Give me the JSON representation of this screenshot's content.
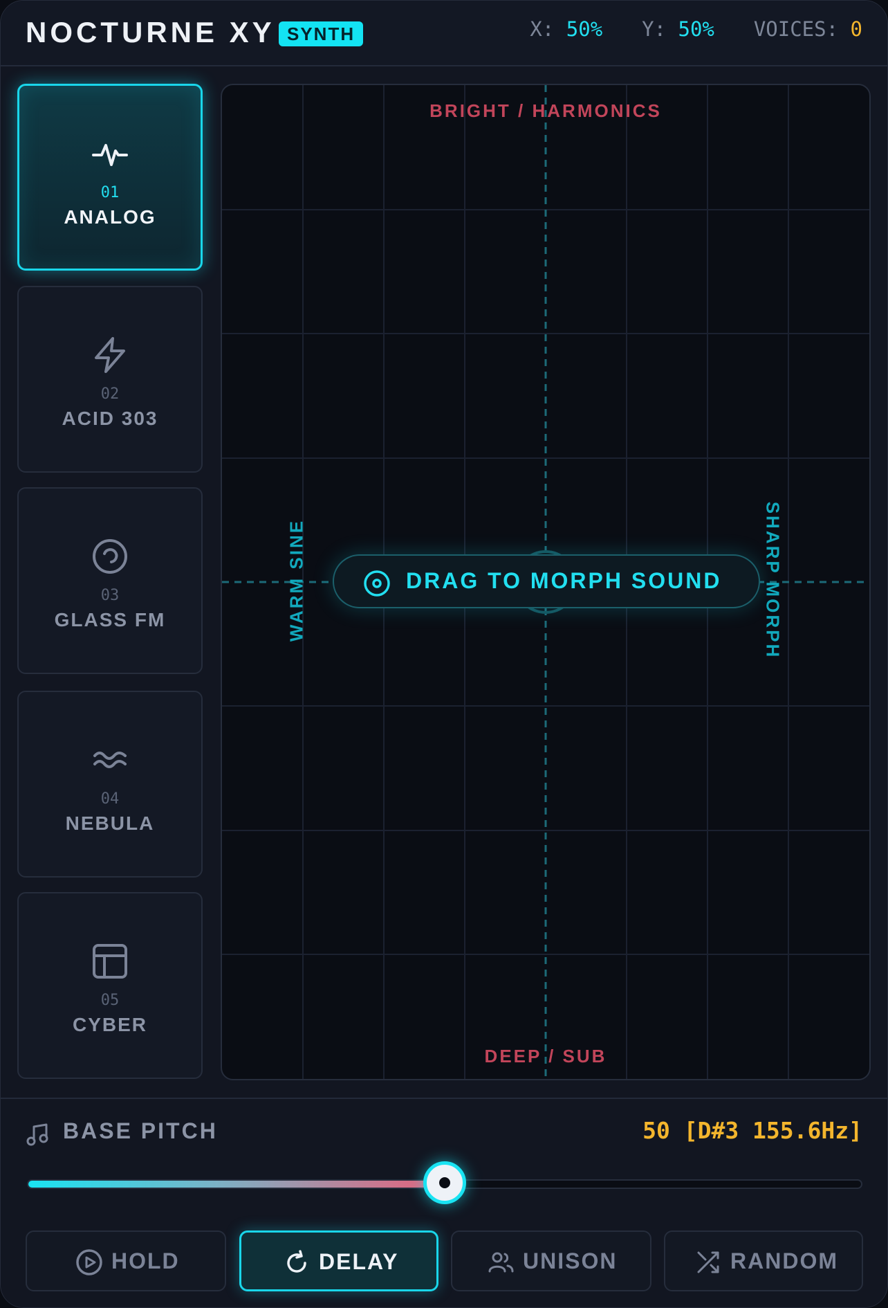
{
  "header": {
    "title": "NOCTURNE XY",
    "badge": "SYNTH",
    "stats": {
      "x_label": "X:",
      "x_value": "50%",
      "y_label": "Y:",
      "y_value": "50%",
      "voices_label": "VOICES:",
      "voices_value": "0"
    }
  },
  "presets": [
    {
      "num": "01",
      "name": "ANALOG",
      "icon": "pulse-wave-icon",
      "active": true
    },
    {
      "num": "02",
      "name": "ACID 303",
      "icon": "lightning-bolt-icon",
      "active": false
    },
    {
      "num": "03",
      "name": "GLASS FM",
      "icon": "spiral-icon",
      "active": false
    },
    {
      "num": "04",
      "name": "NEBULA",
      "icon": "waves-icon",
      "active": false
    },
    {
      "num": "05",
      "name": "CYBER",
      "icon": "layout-panel-icon",
      "active": false
    }
  ],
  "pad": {
    "top_label": "BRIGHT / HARMONICS",
    "bottom_label": "DEEP / SUB",
    "left_label": "WARM SINE",
    "right_label": "SHARP MORPH",
    "hint": "DRAG TO MORPH SOUND",
    "x_percent": 50,
    "y_percent": 50
  },
  "pitch": {
    "label": "BASE PITCH",
    "value_text": "50 [D#3 155.6Hz]",
    "value": 50,
    "min": 0,
    "max": 100
  },
  "toggles": [
    {
      "label": "HOLD",
      "icon": "play-circle-icon",
      "active": false
    },
    {
      "label": "DELAY",
      "icon": "refresh-icon",
      "active": true
    },
    {
      "label": "UNISON",
      "icon": "users-icon",
      "active": false
    },
    {
      "label": "RANDOM",
      "icon": "shuffle-icon",
      "active": false
    }
  ],
  "colors": {
    "accent": "#19e3f2",
    "warm": "#c2455a",
    "amber": "#f3b52d",
    "background": "#0a0d14"
  }
}
